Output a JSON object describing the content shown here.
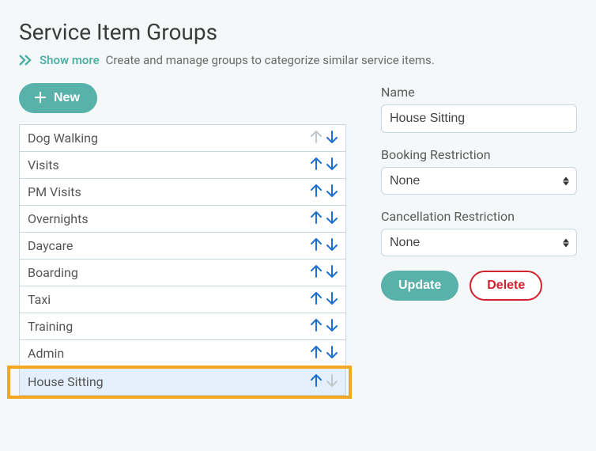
{
  "header": {
    "title": "Service Item Groups",
    "show_more_label": "Show more",
    "subtitle": "Create and manage groups to categorize similar service items."
  },
  "toolbar": {
    "new_label": "New"
  },
  "groups": [
    {
      "label": "Dog Walking",
      "up_disabled": true,
      "down_disabled": false,
      "selected": false
    },
    {
      "label": "Visits",
      "up_disabled": false,
      "down_disabled": false,
      "selected": false
    },
    {
      "label": "PM Visits",
      "up_disabled": false,
      "down_disabled": false,
      "selected": false
    },
    {
      "label": "Overnights",
      "up_disabled": false,
      "down_disabled": false,
      "selected": false
    },
    {
      "label": "Daycare",
      "up_disabled": false,
      "down_disabled": false,
      "selected": false
    },
    {
      "label": "Boarding",
      "up_disabled": false,
      "down_disabled": false,
      "selected": false
    },
    {
      "label": "Taxi",
      "up_disabled": false,
      "down_disabled": false,
      "selected": false
    },
    {
      "label": "Training",
      "up_disabled": false,
      "down_disabled": false,
      "selected": false
    },
    {
      "label": "Admin",
      "up_disabled": false,
      "down_disabled": false,
      "selected": false
    },
    {
      "label": "House Sitting",
      "up_disabled": false,
      "down_disabled": true,
      "selected": true,
      "highlight": true
    }
  ],
  "form": {
    "name_label": "Name",
    "name_value": "House Sitting",
    "booking_label": "Booking Restriction",
    "booking_value": "None",
    "cancellation_label": "Cancellation Restriction",
    "cancellation_value": "None",
    "update_label": "Update",
    "delete_label": "Delete"
  }
}
